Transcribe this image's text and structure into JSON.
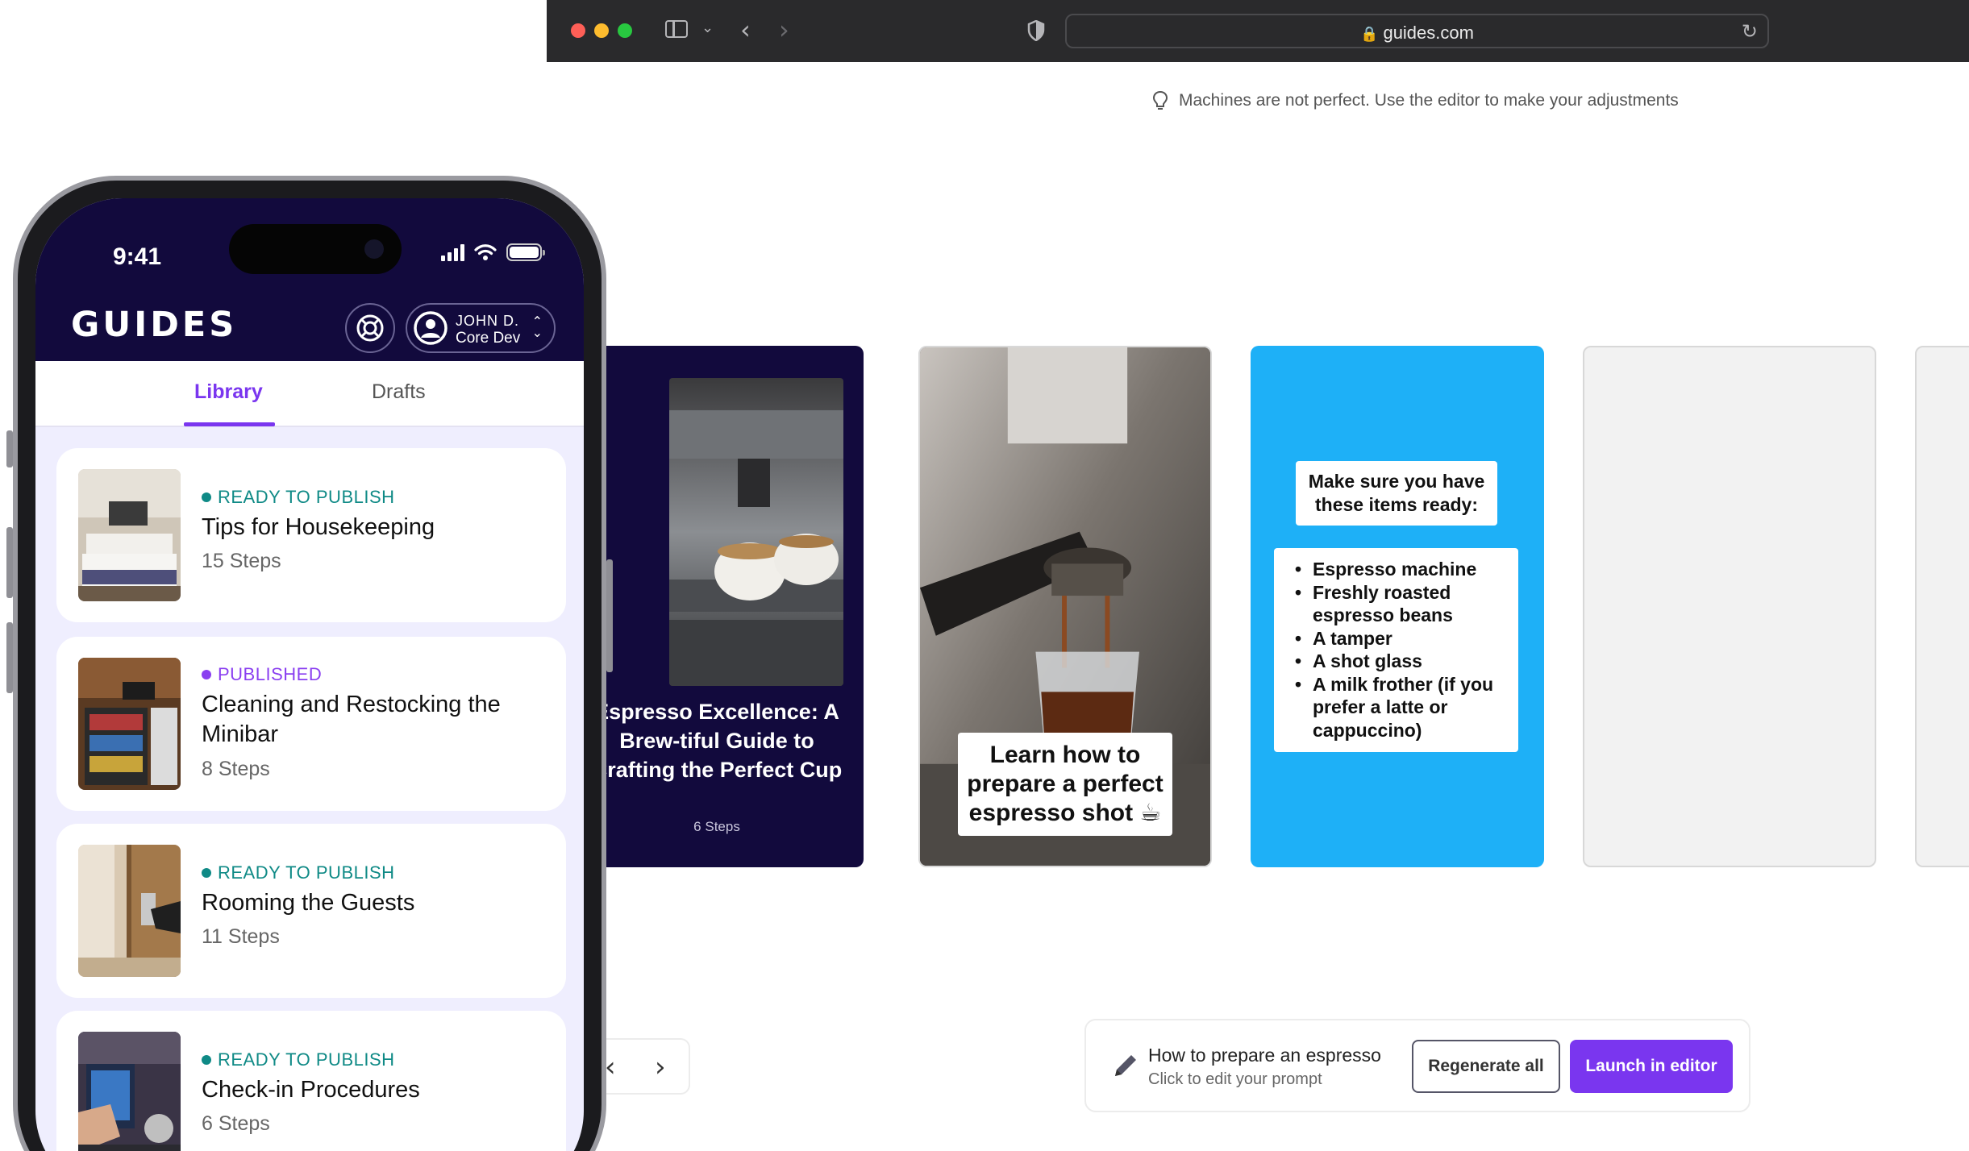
{
  "browser": {
    "url": "guides.com",
    "hint": "Machines are not perfect. Use the editor to make your adjustments"
  },
  "cards": {
    "intro": {
      "title": "Espresso Excellence: A Brew-tiful Guide to Crafting the Perfect Cup",
      "steps": "6 Steps"
    },
    "step1": {
      "caption": "Learn how to prepare a perfect espresso shot ☕"
    },
    "step2": {
      "heading": "Make sure you have these items ready:",
      "items": [
        "Espresso machine",
        "Freshly roasted espresso beans",
        "A tamper",
        "A shot glass",
        "A milk frother (if you prefer a latte or cappuccino)"
      ]
    }
  },
  "prompt": {
    "title": "How to prepare an espresso",
    "subtitle": "Click to edit your prompt",
    "regenerate_label": "Regenerate all",
    "launch_label": "Launch in editor"
  },
  "phone": {
    "time": "9:41",
    "logo": "GUIDES",
    "user": {
      "name": "JOHN D.",
      "role": "Core Dev"
    },
    "tabs": [
      {
        "label": "Library",
        "active": true
      },
      {
        "label": "Drafts",
        "active": false
      }
    ],
    "guides": [
      {
        "status": "READY TO PUBLISH",
        "status_color": "#0f8a86",
        "title": "Tips for Housekeeping",
        "steps": "15 Steps"
      },
      {
        "status": "PUBLISHED",
        "status_color": "#8a3ff0",
        "title": "Cleaning and Restocking the Minibar",
        "steps": "8 Steps"
      },
      {
        "status": "READY TO PUBLISH",
        "status_color": "#0f8a86",
        "title": "Rooming the Guests",
        "steps": "11 Steps"
      },
      {
        "status": "READY TO PUBLISH",
        "status_color": "#0f8a86",
        "title": "Check-in Procedures",
        "steps": "6 Steps"
      }
    ]
  },
  "colors": {
    "brand_dark": "#120a3d",
    "accent": "#7a36ef",
    "card_blue": "#1eb0f7"
  }
}
